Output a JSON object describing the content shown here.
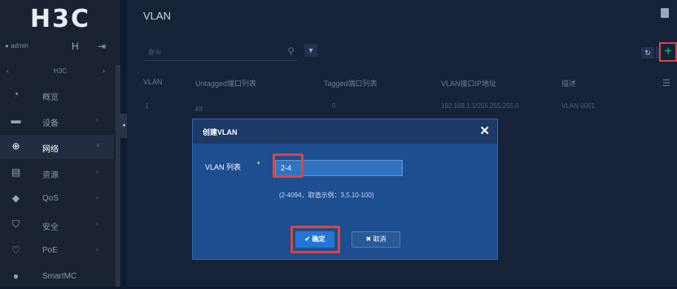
{
  "app": {
    "logo": "H3C",
    "page_title": "VLAN"
  },
  "user": {
    "name": "admin"
  },
  "sidebar": {
    "device_name": "H3C",
    "items": [
      {
        "label": "概览",
        "icon": "dashboard-icon",
        "active": false
      },
      {
        "label": "设备",
        "icon": "device-icon",
        "active": false
      },
      {
        "label": "网络",
        "icon": "globe-icon",
        "active": true
      },
      {
        "label": "资源",
        "icon": "database-icon",
        "active": false
      },
      {
        "label": "QoS",
        "icon": "qos-icon",
        "active": false
      },
      {
        "label": "安全",
        "icon": "shield-icon",
        "active": false
      },
      {
        "label": "PoE",
        "icon": "poe-icon",
        "active": false
      },
      {
        "label": "SmartMC",
        "icon": "smartmc-icon",
        "active": false
      }
    ]
  },
  "toolbar": {
    "search_placeholder": "查询"
  },
  "table": {
    "columns": [
      "VLAN",
      "Untagged端口列表",
      "Tagged端口列表",
      "VLAN接口IP地址",
      "描述"
    ],
    "rows": [
      [
        "1",
        "28",
        "0",
        "192.168.1.1/255.255.255.0",
        "VLAN 0001"
      ]
    ]
  },
  "modal": {
    "title": "创建VLAN",
    "field_label": "VLAN 列表",
    "field_value": "2-4",
    "hint": "(2-4094，取值示例：3,5,10-100)",
    "ok_label": "✔ 确定",
    "cancel_label": "✖ 取消"
  },
  "colors": {
    "accent": "#2576d2",
    "highlight": "#d94545",
    "add": "#38c26b"
  }
}
